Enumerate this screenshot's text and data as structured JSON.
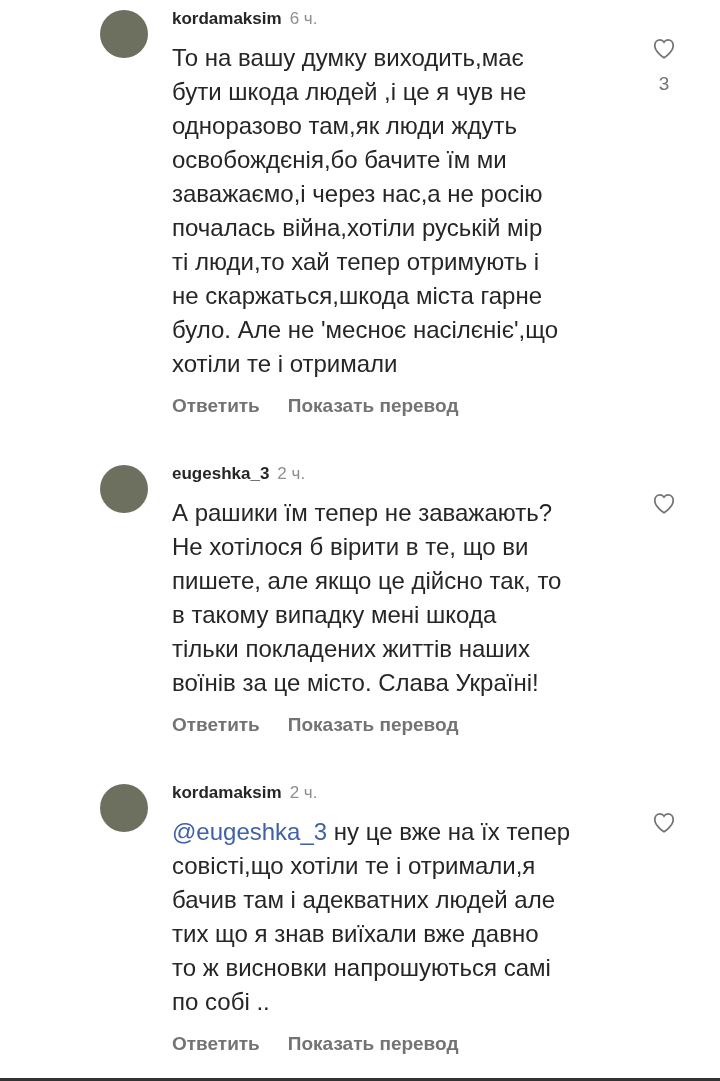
{
  "comments": [
    {
      "username": "kordamaksim",
      "time": "6 ч.",
      "text": "То на вашу думку виходить,має\nбути шкода людей ,і це я чув не\nодноразово там,як люди ждуть\nосвобождєнія,бо бачите їм ми\nзаважаємо,і через нас,а не росію\nпочалась війна,хотіли руській мір\nті люди,то хай тепер отримують і\nне скаржаться,шкода міста гарне\nбуло. Але не 'месноє насілєніє',що\nхотіли те і отримали",
      "liked": false,
      "like_count": "3",
      "actions": [
        "Ответить",
        "Показать перевод"
      ]
    },
    {
      "username": "eugeshka_3",
      "time": "2 ч.",
      "text": "А рашики їм тепер не заважають?\nНе хотілося б вірити в те, що ви\nпишете, але якщо це дійсно так, то\nв такому випадку мені шкода\nтільки покладених життів наших\nвоїнів за це місто. Слава Україні!",
      "liked": false,
      "actions": [
        "Ответить",
        "Показать перевод"
      ]
    },
    {
      "username": "kordamaksim",
      "time": "2 ч.",
      "mention": "@eugeshka_3",
      "text": " ну це вже на їх тепер\nсовісті,що хотіли те і отримали,я\nбачив там і адекватних людей але\nтих що я знав виїхали вже давно\nто ж висновки напрошуються самі\nпо собі ..",
      "liked": false,
      "actions": [
        "Ответить",
        "Показать перевод"
      ]
    }
  ]
}
